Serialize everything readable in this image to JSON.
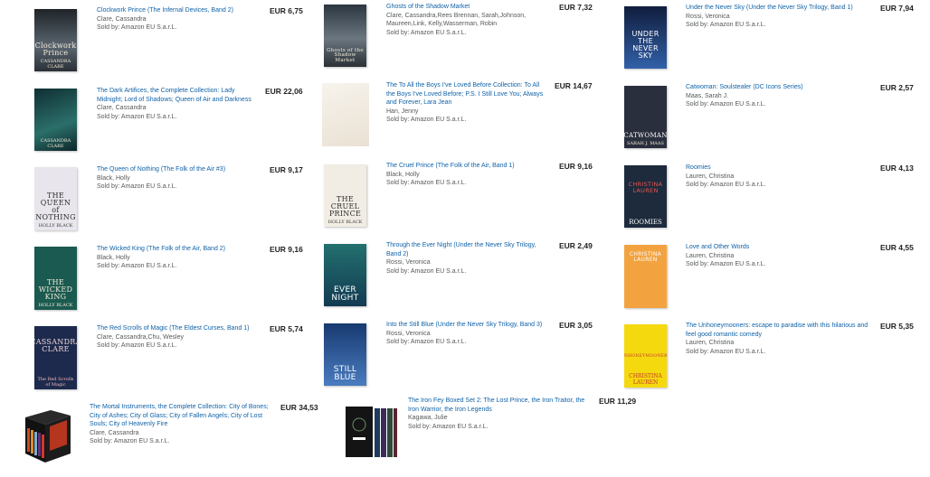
{
  "seller_prefix": "Sold by: ",
  "books": [
    {
      "id": "clockwork-prince",
      "title": "Clockwork Prince (The Infernal Devices, Band 2)",
      "author": "Clare, Cassandra",
      "seller": "Amazon EU S.a.r.L.",
      "price": "EUR 6,75",
      "cover_text": "Clockwork Prince",
      "cover_author": "CASSANDRA CLARE",
      "cover_color": "#3a3f45"
    },
    {
      "id": "dark-artifices",
      "title": "The Dark Artifices, the Complete Collection: Lady Midnight; Lord of Shadows; Queen of Air and Darkness",
      "author": "Clare, Cassandra",
      "seller": "Amazon EU S.a.r.L.",
      "price": "EUR 22,06",
      "cover_text": "",
      "cover_author": "CASSANDRA CLARE",
      "cover_color": "#1f4b4c"
    },
    {
      "id": "queen-of-nothing",
      "title": "The Queen of Nothing (The Folk of the Air #3)",
      "author": "Black, Holly",
      "seller": "Amazon EU S.a.r.L.",
      "price": "EUR 9,17",
      "cover_text": "THE\nQUEEN\nof\nNOTHING",
      "cover_author": "HOLLY BLACK",
      "cover_color": "#e8e6ec"
    },
    {
      "id": "wicked-king",
      "title": "The Wicked King (The Folk of the Air, Band 2)",
      "author": "Black, Holly",
      "seller": "Amazon EU S.a.r.L.",
      "price": "EUR 9,16",
      "cover_text": "THE\nWICKED\nKING",
      "cover_author": "HOLLY BLACK",
      "cover_color": "#1b5a50"
    },
    {
      "id": "red-scrolls",
      "title": "The Red Scrolls of Magic (The Eldest Curses, Band 1)",
      "author": "Clare, Cassandra,Chu, Wesley",
      "seller": "Amazon EU S.a.r.L.",
      "price": "EUR 5,74",
      "cover_text": "CASSANDRA\nCLARE",
      "cover_author": "The Red Scrolls of Magic",
      "cover_color": "#1d2a4d"
    },
    {
      "id": "ghosts-shadow-market",
      "title": "Ghosts of the Shadow Market",
      "author": "Clare, Cassandra,Rees Brennan, Sarah,Johnson, Maureen,Link, Kelly,Wasserman, Robin",
      "seller": "Amazon EU S.a.r.L.",
      "price": "EUR 7,32",
      "cover_text": "Ghosts of the Shadow Market",
      "cover_author": "",
      "cover_color": "#3e4a57"
    },
    {
      "id": "to-all-the-boys",
      "title": "The To All the Boys I've Loved Before Collection: To All the Boys I've Loved Before; P.S. I Still Love You; Always and Forever, Lara Jean",
      "author": "Han, Jenny",
      "seller": "Amazon EU S.a.r.L.",
      "price": "EUR 14,67",
      "cover_text": "",
      "cover_author": "",
      "cover_color": "#f4efe6"
    },
    {
      "id": "cruel-prince",
      "title": "The Cruel Prince (The Folk of the Air, Band 1)",
      "author": "Black, Holly",
      "seller": "Amazon EU S.a.r.L.",
      "price": "EUR 9,16",
      "cover_text": "THE\nCRUEL\nPRINCE",
      "cover_author": "HOLLY BLACK",
      "cover_color": "#f1ede4"
    },
    {
      "id": "through-ever-night",
      "title": "Through the Ever Night (Under the Never Sky Trilogy, Band 2)",
      "author": "Rossi, Veronica",
      "seller": "Amazon EU S.a.r.L.",
      "price": "EUR 2,49",
      "cover_text": "EVER\nNIGHT",
      "cover_author": "",
      "cover_color": "#1f5d6a"
    },
    {
      "id": "into-still-blue",
      "title": "Into the Still Blue (Under the Never Sky Trilogy, Band 3)",
      "author": "Rossi, Veronica",
      "seller": "Amazon EU S.a.r.L.",
      "price": "EUR 3,05",
      "cover_text": "STILL\nBLUE",
      "cover_author": "",
      "cover_color": "#2b4f86"
    },
    {
      "id": "under-never-sky",
      "title": "Under the Never Sky (Under the Never Sky Trilogy, Band 1)",
      "author": "Rossi, Veronica",
      "seller": "Amazon EU S.a.r.L.",
      "price": "EUR 7,94",
      "cover_text": "UNDER THE\nNEVER\nSKY",
      "cover_author": "",
      "cover_color": "#24427a"
    },
    {
      "id": "catwoman",
      "title": "Catwoman: Soulstealer (DC Icons Series)",
      "author": "Maas, Sarah J.",
      "seller": "Amazon EU S.a.r.L.",
      "price": "EUR 2,57",
      "cover_text": "CATWOMAN",
      "cover_author": "SARAH J. MAAS",
      "cover_color": "#2a2f3e"
    },
    {
      "id": "roomies",
      "title": "Roomies",
      "author": "Lauren, Christina",
      "seller": "Amazon EU S.a.r.L.",
      "price": "EUR 4,13",
      "cover_text": "CHRISTINA\nLAUREN",
      "cover_author": "ROOMIES",
      "cover_color": "#1d2b3c"
    },
    {
      "id": "love-and-other-words",
      "title": "Love and Other Words",
      "author": "Lauren, Christina",
      "seller": "Amazon EU S.a.r.L.",
      "price": "EUR 4,55",
      "cover_text": "CHRISTINA\nLAUREN",
      "cover_author": "",
      "cover_color": "#f2a340"
    },
    {
      "id": "unhoneymooners",
      "title": "The Unhoneymooners: escape to paradise with this hilarious and feel good romantic comedy",
      "author": "Lauren, Christina",
      "seller": "Amazon EU S.a.r.L.",
      "price": "EUR 5,35",
      "cover_text": "UNHONEYMOONERS",
      "cover_author": "CHRISTINA\nLAUREN",
      "cover_color": "#f5d90f"
    },
    {
      "id": "mortal-instruments",
      "title": "The Mortal Instruments, the Complete Collection: City of Bones; City of Ashes; City of Glass; City of Fallen Angels; City of Lost Souls; City of Heavenly Fire",
      "author": "Clare, Cassandra",
      "seller": "Amazon EU S.a.r.L.",
      "price": "EUR 34,53",
      "cover_text": "",
      "cover_author": "",
      "cover_color": "#1a1a1a"
    },
    {
      "id": "iron-fey",
      "title": "The Iron Fey Boxed Set 2: The Lost Prince, the Iron Traitor, the Iron Warrior, the Iron Legends",
      "author": "Kagawa, Julie",
      "seller": "Amazon EU S.a.r.L.",
      "price": "EUR 11,29",
      "cover_text": "",
      "cover_author": "",
      "cover_color": "#161616"
    }
  ]
}
